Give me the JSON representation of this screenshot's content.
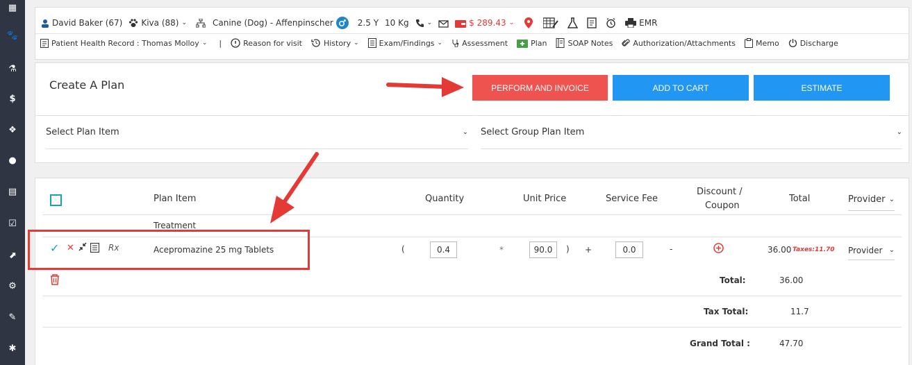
{
  "patient_bar": {
    "client": "David Baker (67)",
    "pet": "Kiva (88)",
    "species": "Canine (Dog) - Affenpinscher",
    "age": "2.5 Y",
    "weight": "10 Kg",
    "balance": "$ 289.43",
    "emr": "EMR"
  },
  "nav_bar": {
    "phr": "Patient Health Record : Thomas Molloy",
    "separator": "|",
    "reason": "Reason for visit",
    "history": "History",
    "exam": "Exam/Findings",
    "assessment": "Assessment",
    "plan": "Plan",
    "soap": "SOAP Notes",
    "auth": "Authorization/Attachments",
    "memo": "Memo",
    "discharge": "Discharge"
  },
  "plan": {
    "title": "Create A Plan",
    "buttons": {
      "perform": "PERFORM AND INVOICE",
      "cart": "ADD TO CART",
      "estimate": "ESTIMATE"
    },
    "select_plan_item": "Select Plan Item",
    "select_group_plan_item": "Select Group Plan Item"
  },
  "table": {
    "headers": {
      "plan_item": "Plan Item",
      "quantity": "Quantity",
      "unit_price": "Unit Price",
      "service_fee": "Service Fee",
      "discount_1": "Discount /",
      "discount_2": "Coupon",
      "total": "Total",
      "provider": "Provider"
    },
    "section": "Treatment",
    "row": {
      "rx": "Rx",
      "name": "Acepromazine 25 mg Tablets",
      "paren_open": "(",
      "quantity": "0.4",
      "times": "*",
      "unit_price": "90.0",
      "paren_close": ")",
      "plus": "+",
      "service_fee": "0.0",
      "minus": "-",
      "total": "36.00",
      "taxes": "Taxes:11.70",
      "provider": "Provider"
    },
    "totals": {
      "total_label": "Total:",
      "total_value": "36.00",
      "tax_label": "Tax Total:",
      "tax_value": "11.7",
      "grand_label": "Grand Total :",
      "grand_value": "47.70"
    }
  },
  "colors": {
    "perform": "#ef5350",
    "cart": "#2196f3",
    "estimate": "#2196f3",
    "sidebar": "#2f3542",
    "accent_teal": "#17a2b8",
    "annotation": "#e53935"
  }
}
